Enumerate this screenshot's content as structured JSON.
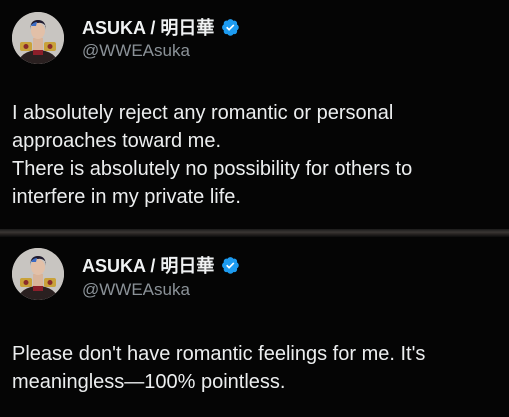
{
  "posts": [
    {
      "author": {
        "display_name": "ASUKA / 明日華",
        "handle": "@WWEAsuka",
        "avatar_icon": "wrestler-avatar",
        "verified_icon": "verified-badge-icon",
        "verified_color": "#1d9bf0"
      },
      "text_lines": [
        "I absolutely reject any romantic or personal",
        "approaches toward me.",
        "There is absolutely no possibility for others to",
        "interfere in my private life."
      ]
    },
    {
      "author": {
        "display_name": "ASUKA / 明日華",
        "handle": "@WWEAsuka",
        "avatar_icon": "wrestler-avatar",
        "verified_icon": "verified-badge-icon",
        "verified_color": "#1d9bf0"
      },
      "text_lines": [
        "Please don't have romantic feelings for me. It's",
        "meaningless—100% pointless."
      ]
    }
  ],
  "colors": {
    "background": "#000000",
    "text": "#e7e9ea",
    "handle": "#8b9298",
    "verified": "#1d9bf0"
  }
}
